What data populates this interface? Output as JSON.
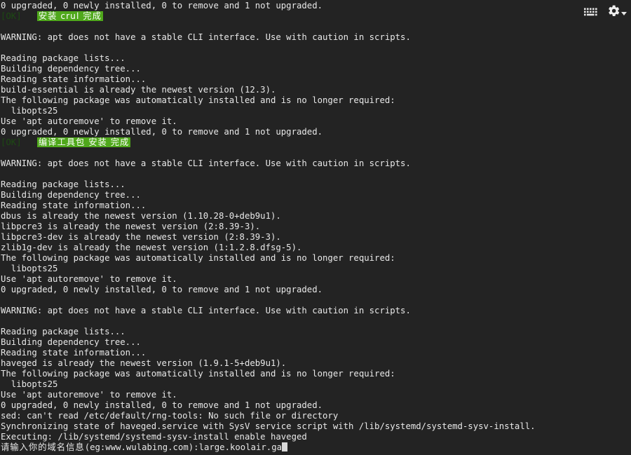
{
  "app": {
    "type": "terminal",
    "background_color": "#232323",
    "foreground_color": "#e8e8e8",
    "highlight_green": "#4fa81b",
    "ok_tag_color": "#1d4a13"
  },
  "toolbar": {
    "keyboard_icon_label": "keyboard",
    "settings_icon_label": "settings",
    "dropdown_icon_label": "chevron-down"
  },
  "terminal": {
    "lines": [
      {
        "id": "l1",
        "text": "0 upgraded, 0 newly installed, 0 to remove and 1 not upgraded."
      },
      {
        "id": "l2",
        "ok": "[OK]",
        "highlight": "安装 crul 完成"
      },
      {
        "id": "l3",
        "text": ""
      },
      {
        "id": "l4",
        "text": "WARNING: apt does not have a stable CLI interface. Use with caution in scripts."
      },
      {
        "id": "l5",
        "text": ""
      },
      {
        "id": "l6",
        "text": "Reading package lists..."
      },
      {
        "id": "l7",
        "text": "Building dependency tree..."
      },
      {
        "id": "l8",
        "text": "Reading state information..."
      },
      {
        "id": "l9",
        "text": "build-essential is already the newest version (12.3)."
      },
      {
        "id": "l10",
        "text": "The following package was automatically installed and is no longer required:"
      },
      {
        "id": "l11",
        "text": "  libopts25"
      },
      {
        "id": "l12",
        "text": "Use 'apt autoremove' to remove it."
      },
      {
        "id": "l13",
        "text": "0 upgraded, 0 newly installed, 0 to remove and 1 not upgraded."
      },
      {
        "id": "l14",
        "ok": "[OK]",
        "highlight": "编译工具包 安装 完成"
      },
      {
        "id": "l15",
        "text": ""
      },
      {
        "id": "l16",
        "text": "WARNING: apt does not have a stable CLI interface. Use with caution in scripts."
      },
      {
        "id": "l17",
        "text": ""
      },
      {
        "id": "l18",
        "text": "Reading package lists..."
      },
      {
        "id": "l19",
        "text": "Building dependency tree..."
      },
      {
        "id": "l20",
        "text": "Reading state information..."
      },
      {
        "id": "l21",
        "text": "dbus is already the newest version (1.10.28-0+deb9u1)."
      },
      {
        "id": "l22",
        "text": "libpcre3 is already the newest version (2:8.39-3)."
      },
      {
        "id": "l23",
        "text": "libpcre3-dev is already the newest version (2:8.39-3)."
      },
      {
        "id": "l24",
        "text": "zlib1g-dev is already the newest version (1:1.2.8.dfsg-5)."
      },
      {
        "id": "l25",
        "text": "The following package was automatically installed and is no longer required:"
      },
      {
        "id": "l26",
        "text": "  libopts25"
      },
      {
        "id": "l27",
        "text": "Use 'apt autoremove' to remove it."
      },
      {
        "id": "l28",
        "text": "0 upgraded, 0 newly installed, 0 to remove and 1 not upgraded."
      },
      {
        "id": "l29",
        "text": ""
      },
      {
        "id": "l30",
        "text": "WARNING: apt does not have a stable CLI interface. Use with caution in scripts."
      },
      {
        "id": "l31",
        "text": ""
      },
      {
        "id": "l32",
        "text": "Reading package lists..."
      },
      {
        "id": "l33",
        "text": "Building dependency tree..."
      },
      {
        "id": "l34",
        "text": "Reading state information..."
      },
      {
        "id": "l35",
        "text": "haveged is already the newest version (1.9.1-5+deb9u1)."
      },
      {
        "id": "l36",
        "text": "The following package was automatically installed and is no longer required:"
      },
      {
        "id": "l37",
        "text": "  libopts25"
      },
      {
        "id": "l38",
        "text": "Use 'apt autoremove' to remove it."
      },
      {
        "id": "l39",
        "text": "0 upgraded, 0 newly installed, 0 to remove and 1 not upgraded."
      },
      {
        "id": "l40",
        "text": "sed: can't read /etc/default/rng-tools: No such file or directory"
      },
      {
        "id": "l41",
        "text": "Synchronizing state of haveged.service with SysV service script with /lib/systemd/systemd-sysv-install."
      },
      {
        "id": "l42",
        "text": "Executing: /lib/systemd/systemd-sysv-install enable haveged"
      }
    ],
    "prompt": {
      "cjk_text": "请输入你的域名信息",
      "ascii_text": "(eg:www.wulabing.com):",
      "input_value": "large.koolair.ga"
    }
  }
}
